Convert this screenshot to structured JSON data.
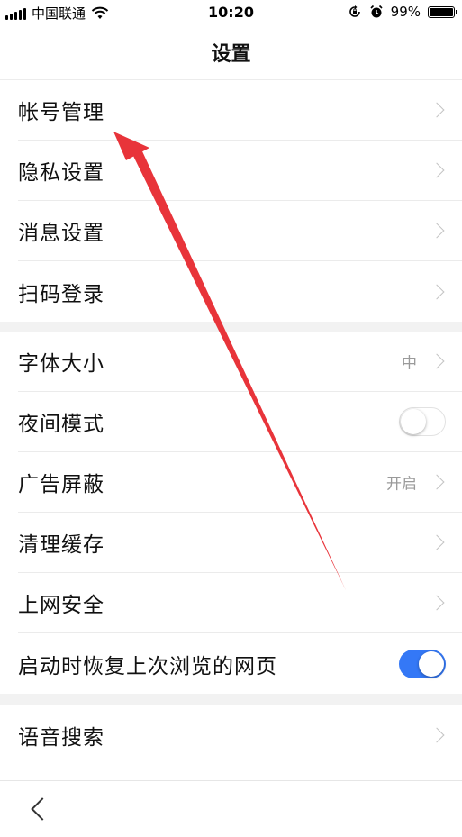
{
  "status_bar": {
    "carrier": "中国联通",
    "time": "10:20",
    "battery": "99%",
    "battery_level": 0.99
  },
  "header": {
    "title": "设置"
  },
  "groups": [
    {
      "items": [
        {
          "label": "帐号管理",
          "accessory": "chevron"
        },
        {
          "label": "隐私设置",
          "accessory": "chevron"
        },
        {
          "label": "消息设置",
          "accessory": "chevron"
        },
        {
          "label": "扫码登录",
          "accessory": "chevron"
        }
      ]
    },
    {
      "items": [
        {
          "label": "字体大小",
          "value": "中",
          "accessory": "chevron"
        },
        {
          "label": "夜间模式",
          "accessory": "toggle",
          "toggle_on": false
        },
        {
          "label": "广告屏蔽",
          "value": "开启",
          "accessory": "chevron"
        },
        {
          "label": "清理缓存",
          "accessory": "chevron"
        },
        {
          "label": "上网安全",
          "accessory": "chevron"
        },
        {
          "label": "启动时恢复上次浏览的网页",
          "accessory": "toggle",
          "toggle_on": true
        }
      ]
    },
    {
      "items": [
        {
          "label": "语音搜索",
          "accessory": "chevron"
        }
      ]
    }
  ],
  "colors": {
    "toggle_on": "#3478f6",
    "annotation_arrow": "#e8343a",
    "section_gap": "#f2f2f2"
  },
  "icons": {
    "back": "chevron-left-icon",
    "row_chevron": "chevron-right-icon",
    "wifi": "wifi-icon",
    "alarm": "alarm-icon",
    "rotation_lock": "rotation-lock-icon"
  }
}
